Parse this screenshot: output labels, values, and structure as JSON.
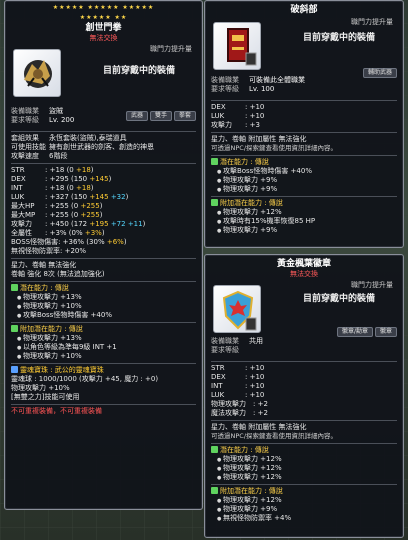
{
  "panel1": {
    "stars_top": "★★★★★  ★★★★★  ★★★★★",
    "stars_bottom": "★★★★★  ★★",
    "title": "創世門拳",
    "subtitle": "無法交換",
    "job_tag": "職門力提升量",
    "equipped_text": "目前穿戴中的裝備",
    "req": [
      {
        "k": "裝備職業",
        "v": "盜賊"
      },
      {
        "k": "要求等級",
        "v": "Lv. 200"
      }
    ],
    "tabs": [
      "武器",
      "雙手",
      "拳套"
    ],
    "info": [
      {
        "k": "套組效果",
        "v": "永恆套裝(盜賊),泰瑞道具"
      },
      {
        "k": "可使用技能",
        "v": "擁有創世武器的劍客、創造的神恩"
      },
      {
        "k": "攻擊速度",
        "v": "6階段"
      }
    ],
    "stats": [
      {
        "k": "STR",
        "v": ": +18 (0 ",
        "g": "+18",
        "e": ")"
      },
      {
        "k": "DEX",
        "v": ": +295 (150 ",
        "g": "+145",
        "e": ")"
      },
      {
        "k": "INT",
        "v": ": +18 (0 ",
        "g": "+18",
        "e": ")"
      },
      {
        "k": "LUK",
        "v": ": +327 (150 ",
        "g": "+145",
        "c": " +32",
        "e": ")"
      },
      {
        "k": "最大HP",
        "v": ": +255 (0 ",
        "g": "+255",
        "e": ")"
      },
      {
        "k": "最大MP",
        "v": ": +255 (0 ",
        "g": "+255",
        "e": ")"
      },
      {
        "k": "攻擊力",
        "v": ": +450 (172 ",
        "g": "+195",
        "c": " +72 +11",
        "e": ")"
      },
      {
        "k": "全屬性",
        "v": ": +3% (0% ",
        "g": "+3%",
        "e": ")"
      },
      {
        "k": "BOSS怪物傷害",
        "v": ": +36% (30% ",
        "g": "+6%",
        "e": ")"
      },
      {
        "k": "無視怪物防禦率",
        "v": ": +20%",
        "g": "",
        "e": ""
      }
    ],
    "star_force": "星力、卷軸  無法強化",
    "scroll_line": "卷軸 強化 8次 (無法追加強化)",
    "potential_title": "潛在能力 : 傳說",
    "potential": [
      "物理攻擊力 +13%",
      "物理攻擊力 +10%",
      "攻擊Boss怪物時傷害 +40%"
    ],
    "addpot_title": "附加潛在能力 : 傳說",
    "addpot": [
      "物理攻擊力 +13%",
      "以角色等級為準每9級 INT +1",
      "物理攻擊力 +10%"
    ],
    "soul_title": "靈魂寶珠 : 武公的靈魂寶珠",
    "soul_line": "靈魂球 : 1000/1000 (攻擊力 +45, 魔力 : +0)",
    "soul_line2": "物理攻擊力 +10%",
    "soul_skill": "[無雙之力]技能可使用",
    "warn": "不可重複裝備，不可重複裝備"
  },
  "panel2": {
    "title": "破斜部",
    "job_tag": "職門力提升量",
    "equipped_text": "目前穿戴中的裝備",
    "req": [
      {
        "k": "裝備職業",
        "v": "可裝備此全體職業"
      },
      {
        "k": "要求等級",
        "v": "Lv. 100"
      }
    ],
    "tabs": [
      "輔助武器"
    ],
    "stats": [
      {
        "k": "DEX",
        "v": ": +10"
      },
      {
        "k": "LUK",
        "v": ": +10"
      },
      {
        "k": "攻擊力",
        "v": ": +3"
      }
    ],
    "star_force": "星力、卷軸  附加屬性  無法強化",
    "note": "可透過NPC/探索鍵查看使用資訊詳細內容。",
    "potential_title": "潛在能力 : 傳說",
    "potential": [
      "攻擊Boss怪物時傷害 +40%",
      "物理攻擊力 +9%",
      "物理攻擊力 +9%"
    ],
    "addpot_title": "附加潛在能力 : 傳說",
    "addpot": [
      "物理攻擊力 +12%",
      "攻擊時有15%機率恢復85 HP",
      "物理攻擊力 +9%"
    ]
  },
  "panel3": {
    "title": "黃金楓葉徽章",
    "subtitle": "無法交換",
    "job_tag": "職門力提升量",
    "equipped_text": "目前穿戴中的裝備",
    "req": [
      {
        "k": "裝備職業",
        "v": "共用"
      },
      {
        "k": "要求等級",
        "v": ""
      }
    ],
    "tabs": [
      "徽章/勳章",
      "徽章"
    ],
    "stats": [
      {
        "k": "STR",
        "v": ": +10"
      },
      {
        "k": "DEX",
        "v": ": +10"
      },
      {
        "k": "INT",
        "v": ": +10"
      },
      {
        "k": "LUK",
        "v": ": +10"
      },
      {
        "k": "物理攻擊力",
        "v": ": +2"
      },
      {
        "k": "魔法攻擊力",
        "v": ": +2"
      }
    ],
    "star_force": "星力、卷軸  附加屬性  無法強化",
    "note": "可透過NPC/探索鍵查看使用資訊詳細內容。",
    "potential_title": "潛在能力 : 傳說",
    "potential": [
      "物理攻擊力 +12%",
      "物理攻擊力 +12%",
      "物理攻擊力 +12%"
    ],
    "addpot_title": "附加潛在能力 : 傳說",
    "addpot": [
      "物理攻擊力 +12%",
      "物理攻擊力 +9%",
      "無視怪物防禦率 +4%"
    ]
  }
}
